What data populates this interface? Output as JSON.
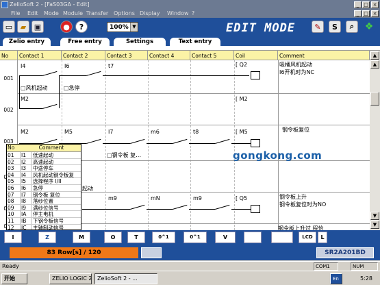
{
  "window": {
    "title": "ZelioSoft 2 - [FaS03GA - Edit]",
    "controls": [
      "_",
      "□",
      "×"
    ]
  },
  "menu": [
    "File",
    "Edit",
    "Mode",
    "Module",
    "Transfer",
    "Options",
    "Display",
    "Window",
    "?"
  ],
  "toolbar": {
    "zoom": "100%",
    "mode_label": "EDIT MODE",
    "s_button": "S"
  },
  "tabs": [
    "Zelio entry",
    "Free entry",
    "Settings",
    "Text entry"
  ],
  "table": {
    "headers": [
      "No",
      "Contact 1",
      "Contact 2",
      "Contact 3",
      "Contact 4",
      "Contact 5",
      "Coil",
      "Comment"
    ],
    "rows": [
      {
        "no": "001",
        "c1": "I4",
        "c2": "I6",
        "c3": "t7",
        "c4": "",
        "c5": "",
        "coil": "Q2",
        "c1_note": "□风机起动",
        "c2_note": "□急停",
        "comment1": "吸桶风机起动",
        "comment2": "I6开机时为NC"
      },
      {
        "no": "002",
        "c1": "M2",
        "c2": "",
        "c3": "",
        "c4": "",
        "c5": "",
        "coil": "M2",
        "comment1": "",
        "comment2": ""
      },
      {
        "no": "003",
        "c1": "M2",
        "c2": "M5",
        "c3": "I7",
        "c4": "m6",
        "c5": "t8",
        "coil": "M5",
        "c3_note": "□钢令板 复…",
        "comment1": "钢令板复位",
        "comment2": ""
      },
      {
        "no": "004",
        "c2_note": "起动",
        "comment1": "",
        "comment2": ""
      },
      {
        "no": "005",
        "c3": "m9",
        "c4": "mN",
        "c5": "m9",
        "coil": "Q5",
        "comment1": "钢令板上升",
        "comment2": "钢令板复位时为NO"
      },
      {
        "no": "006",
        "comment1": "钢令板上升过 程恰",
        "comment2": ""
      }
    ]
  },
  "popup": {
    "headers": [
      "No",
      "Comment"
    ],
    "rows": [
      {
        "n": "01",
        "c": "I1",
        "m": "低速起动"
      },
      {
        "n": "02",
        "c": "I2",
        "m": "高速起动"
      },
      {
        "n": "03",
        "c": "I3",
        "m": "中途停车"
      },
      {
        "n": "04",
        "c": "I4",
        "m": "风机起动钢令板复"
      },
      {
        "n": "05",
        "c": "I5",
        "m": "选择程序 I/II"
      },
      {
        "n": "06",
        "c": "I6",
        "m": "急停"
      },
      {
        "n": "07",
        "c": "I7",
        "m": "钢令板 复位"
      },
      {
        "n": "08",
        "c": "I8",
        "m": "落纱位置"
      },
      {
        "n": "09",
        "c": "I9",
        "m": "满纱位信号"
      },
      {
        "n": "10",
        "c": "IA",
        "m": "停主电机"
      },
      {
        "n": "11",
        "c": "IB",
        "m": "下钢令板信号"
      },
      {
        "n": "12",
        "c": "IC",
        "m": "主轴制动信号"
      }
    ]
  },
  "bottom_buttons": [
    "I",
    "Z",
    "M",
    "O",
    "T",
    "0^1",
    "0^1",
    "V",
    "",
    "",
    "LCD",
    "L"
  ],
  "status": {
    "rows": "83 Row[s] / 120",
    "model": "SR2A201BD"
  },
  "readybar": {
    "text": "Ready",
    "port": "COM1",
    "num": "NUM"
  },
  "taskbar": {
    "start": "开始",
    "tasks": [
      "ZELIO LOGIC 2 ...",
      "ZelioSoft 2 - ..."
    ],
    "lang": "En",
    "time": "5:28"
  },
  "watermark": "gongkong.com",
  "colors": {
    "toolbar_blue": "#1f4f9a",
    "header_yellow": "#fbf3a6",
    "rows_orange": "#f07818"
  }
}
